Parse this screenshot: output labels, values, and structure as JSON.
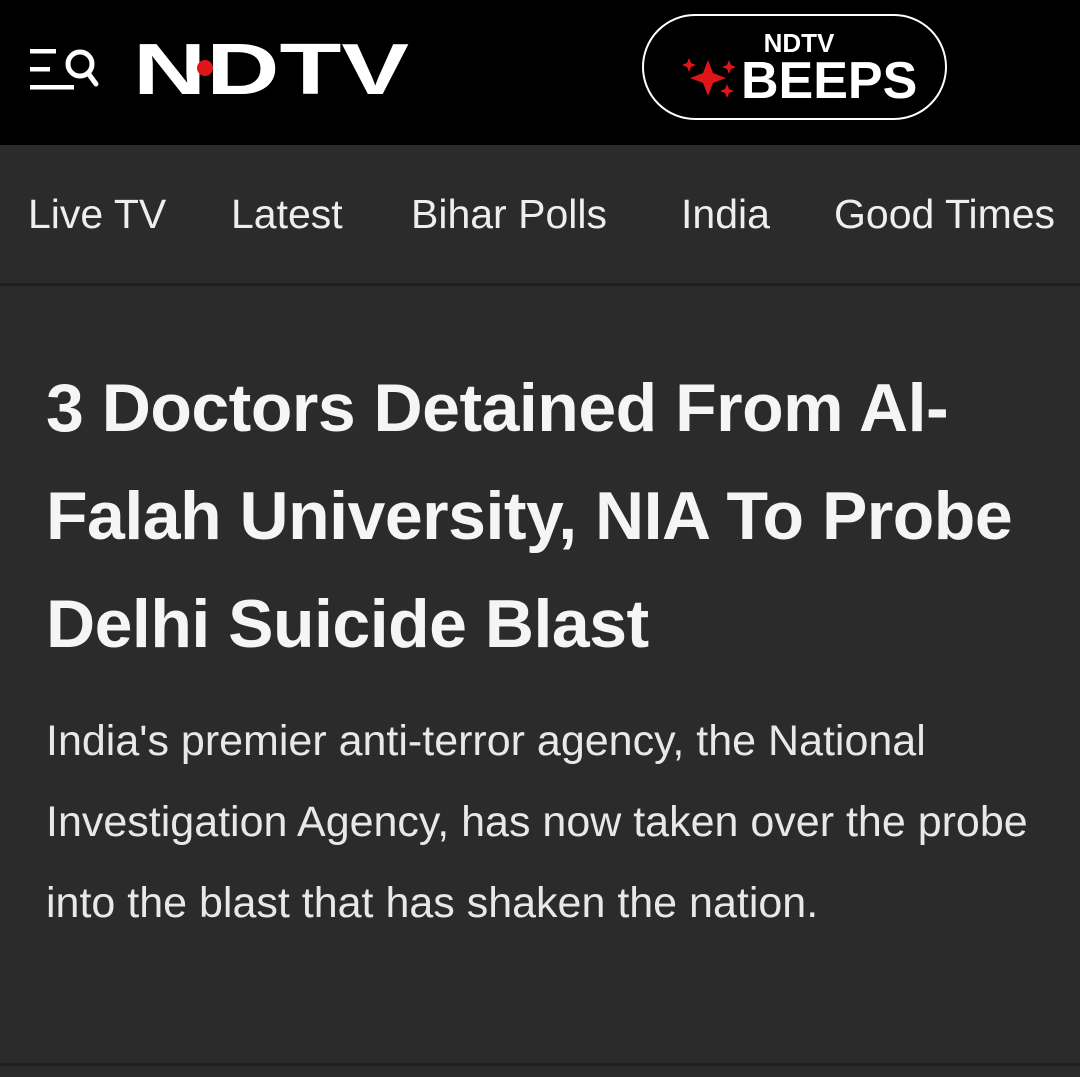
{
  "header": {
    "logo_text": "NDTV",
    "menu_icon": "menu-search-icon",
    "beeps": {
      "brand_small": "NDTV",
      "label": "BEEPS",
      "icon": "sparkles-icon",
      "accent": "#e0151a"
    }
  },
  "nav": {
    "items": [
      {
        "label": "Live TV"
      },
      {
        "label": "Latest"
      },
      {
        "label": "Bihar Polls"
      },
      {
        "label": "India"
      },
      {
        "label": "Good Times"
      }
    ]
  },
  "article": {
    "headline": "3 Doctors Detained From Al-Falah University, NIA To Probe Delhi Suicide Blast",
    "summary": "India's premier anti-terror agency, the National Investigation Agency, has now taken over the probe into the blast that has shaken the nation."
  },
  "colors": {
    "topbar": "#000000",
    "background": "#2b2b2b",
    "text": "#f5f5f5",
    "brand_red": "#e0151a"
  }
}
